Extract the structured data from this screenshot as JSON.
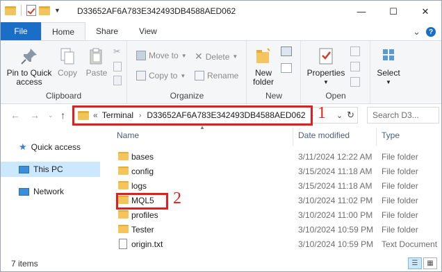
{
  "window": {
    "title": "D33652AF6A783E342493DB4588AED062",
    "minimize": "—",
    "maximize": "☐",
    "close": "✕"
  },
  "tabs": {
    "file": "File",
    "home": "Home",
    "share": "Share",
    "view": "View",
    "expand": "⌄",
    "help": "?"
  },
  "ribbon": {
    "clipboard": {
      "label": "Clipboard",
      "pin_line1": "Pin to Quick",
      "pin_line2": "access",
      "copy": "Copy",
      "paste": "Paste"
    },
    "organize": {
      "label": "Organize",
      "move_to": "Move to",
      "copy_to": "Copy to",
      "delete": "Delete",
      "rename": "Rename"
    },
    "new": {
      "label": "New",
      "new_folder_line1": "New",
      "new_folder_line2": "folder"
    },
    "open": {
      "label": "Open",
      "properties": "Properties"
    },
    "select": {
      "label": "Select"
    }
  },
  "address": {
    "prefix": "«",
    "crumb1": "Terminal",
    "crumb2": "D33652AF6A783E342493DB4588AED062",
    "search_placeholder": "Search D3..."
  },
  "annotations": {
    "label1": "1",
    "label2": "2",
    "color": "#e02020"
  },
  "nav": {
    "quick_access": "Quick access",
    "this_pc": "This PC",
    "network": "Network"
  },
  "columns": {
    "name": "Name",
    "date_modified": "Date modified",
    "type": "Type"
  },
  "files": [
    {
      "name": "bases",
      "date": "3/11/2024 12:22 AM",
      "type": "File folder",
      "kind": "folder"
    },
    {
      "name": "config",
      "date": "3/15/2024 11:18 AM",
      "type": "File folder",
      "kind": "folder"
    },
    {
      "name": "logs",
      "date": "3/15/2024 11:18 AM",
      "type": "File folder",
      "kind": "folder"
    },
    {
      "name": "MQL5",
      "date": "3/10/2024 11:02 PM",
      "type": "File folder",
      "kind": "folder"
    },
    {
      "name": "profiles",
      "date": "3/10/2024 11:00 PM",
      "type": "File folder",
      "kind": "folder"
    },
    {
      "name": "Tester",
      "date": "3/10/2024 10:59 PM",
      "type": "File folder",
      "kind": "folder"
    },
    {
      "name": "origin.txt",
      "date": "3/10/2024 10:59 PM",
      "type": "Text Document",
      "kind": "text"
    }
  ],
  "status": {
    "items": "7 items"
  },
  "colors": {
    "accent": "#1a6ec7",
    "selection": "#cce8ff",
    "folder": "#f3c55c"
  }
}
